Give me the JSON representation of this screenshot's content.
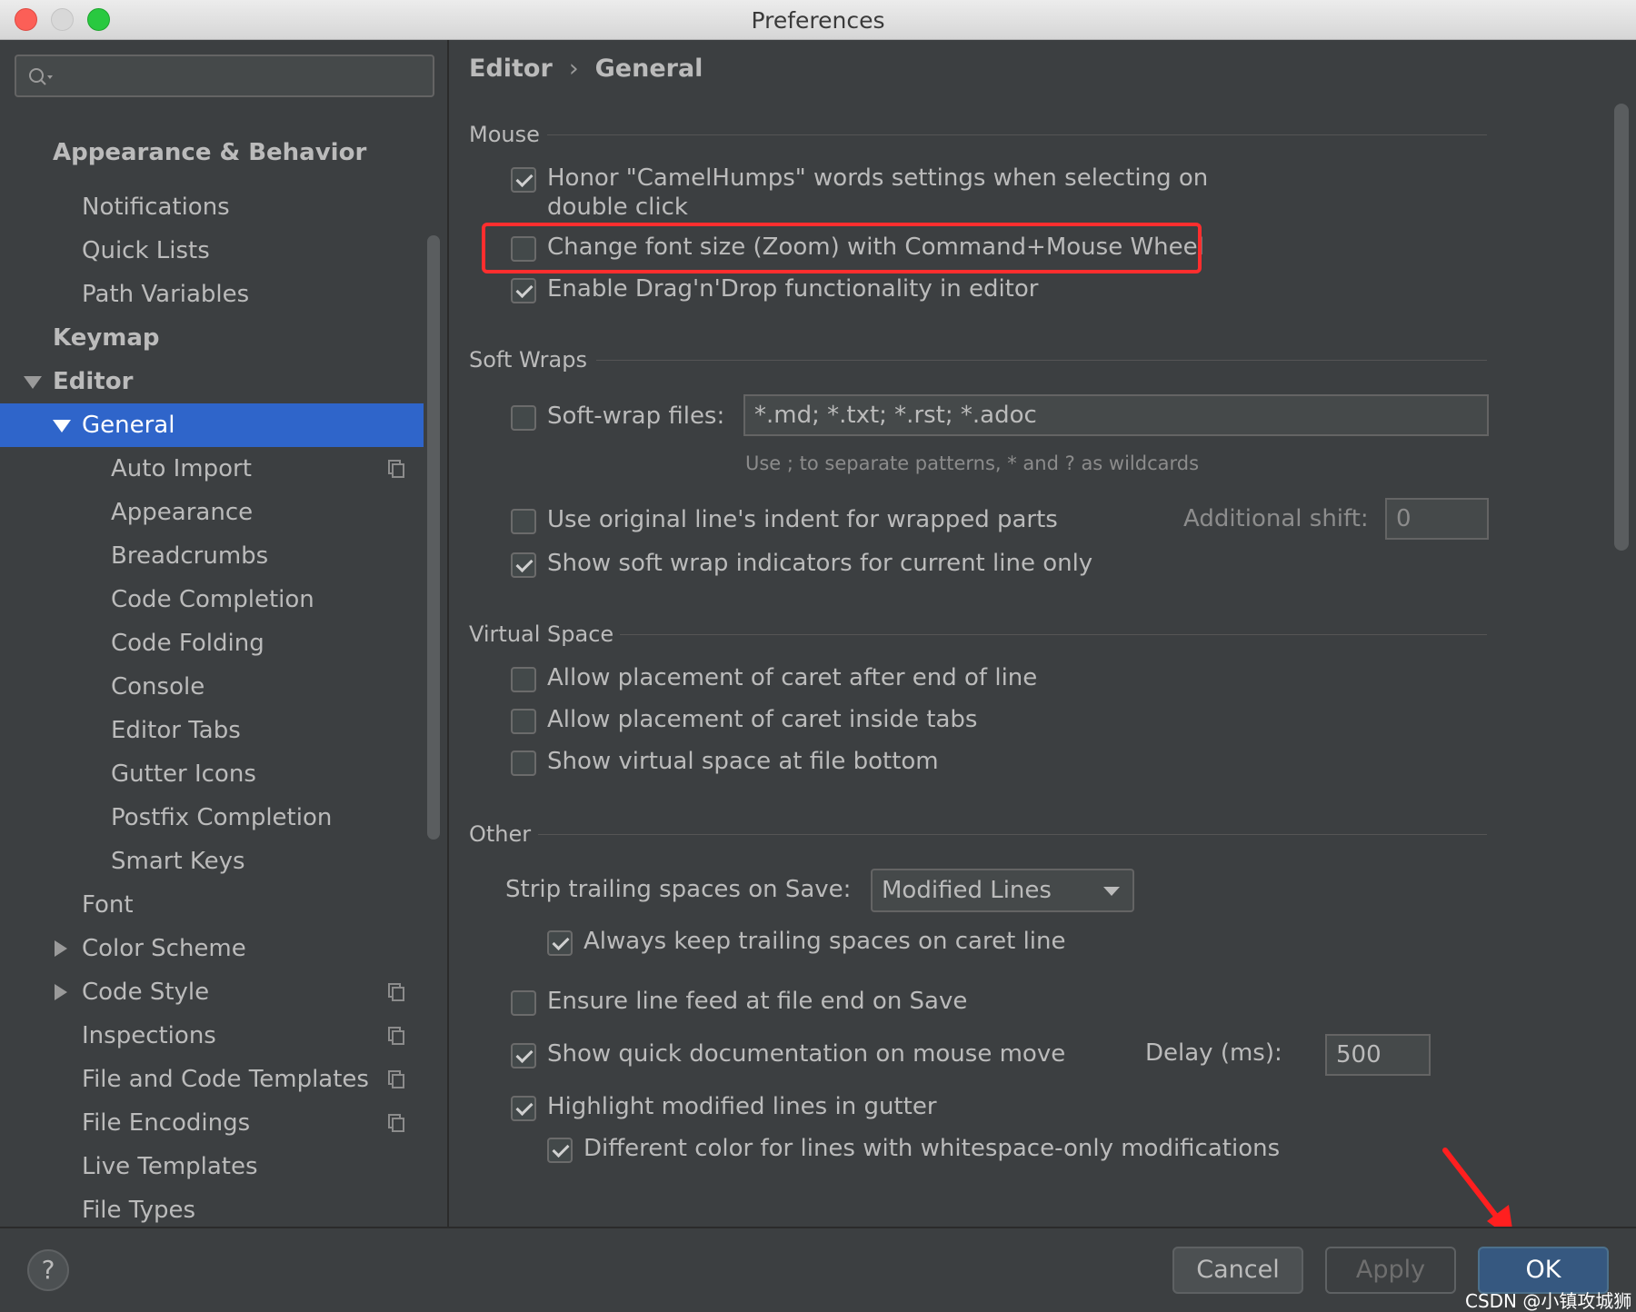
{
  "window": {
    "title": "Preferences"
  },
  "sidebar": {
    "search_placeholder": "",
    "items": [
      {
        "label": "Appearance & Behavior",
        "level": 0,
        "bold": true
      },
      {
        "label": "Notifications",
        "level": 1
      },
      {
        "label": "Quick Lists",
        "level": 1
      },
      {
        "label": "Path Variables",
        "level": 1
      },
      {
        "label": "Keymap",
        "level": 0,
        "bold": true
      },
      {
        "label": "Editor",
        "level": 0,
        "bold": true,
        "expanded": true
      },
      {
        "label": "General",
        "level": 1,
        "expanded": true,
        "selected": true
      },
      {
        "label": "Auto Import",
        "level": 2,
        "icon": "copy-icon"
      },
      {
        "label": "Appearance",
        "level": 2
      },
      {
        "label": "Breadcrumbs",
        "level": 2
      },
      {
        "label": "Code Completion",
        "level": 2
      },
      {
        "label": "Code Folding",
        "level": 2
      },
      {
        "label": "Console",
        "level": 2
      },
      {
        "label": "Editor Tabs",
        "level": 2
      },
      {
        "label": "Gutter Icons",
        "level": 2
      },
      {
        "label": "Postfix Completion",
        "level": 2
      },
      {
        "label": "Smart Keys",
        "level": 2
      },
      {
        "label": "Font",
        "level": 1
      },
      {
        "label": "Color Scheme",
        "level": 1,
        "collapsed": true
      },
      {
        "label": "Code Style",
        "level": 1,
        "collapsed": true,
        "icon": "copy-icon"
      },
      {
        "label": "Inspections",
        "level": 1,
        "icon": "copy-icon"
      },
      {
        "label": "File and Code Templates",
        "level": 1,
        "icon": "copy-icon"
      },
      {
        "label": "File Encodings",
        "level": 1,
        "icon": "copy-icon"
      },
      {
        "label": "Live Templates",
        "level": 1
      },
      {
        "label": "File Types",
        "level": 1
      }
    ]
  },
  "breadcrumb": {
    "parent": "Editor",
    "sep": "›",
    "current": "General"
  },
  "mouse": {
    "title": "Mouse",
    "camelhumps_line1": "Honor \"CamelHumps\" words settings when selecting on",
    "camelhumps_line2": "double click",
    "camelhumps_checked": true,
    "zoom_label": "Change font size (Zoom) with Command+Mouse Wheel",
    "zoom_checked": false,
    "dragdrop_label": "Enable Drag'n'Drop functionality in editor",
    "dragdrop_checked": true
  },
  "soft_wraps": {
    "title": "Soft Wraps",
    "softwrap_label": "Soft-wrap files:",
    "softwrap_checked": false,
    "patterns_value": "*.md; *.txt; *.rst; *.adoc",
    "hint": "Use ; to separate patterns, * and ? as wildcards",
    "indent_label": "Use original line's indent for wrapped parts",
    "indent_checked": false,
    "shift_label": "Additional shift:",
    "shift_value": "0",
    "indicators_label": "Show soft wrap indicators for current line only",
    "indicators_checked": true
  },
  "virtual_space": {
    "title": "Virtual Space",
    "after_end_label": "Allow placement of caret after end of line",
    "inside_tabs_label": "Allow placement of caret inside tabs",
    "file_bottom_label": "Show virtual space at file bottom"
  },
  "other": {
    "title": "Other",
    "strip_label": "Strip trailing spaces on Save:",
    "strip_value": "Modified Lines",
    "keep_trailing_label": "Always keep trailing spaces on caret line",
    "line_feed_label": "Ensure line feed at file end on Save",
    "quick_doc_label": "Show quick documentation on mouse move",
    "delay_label": "Delay (ms):",
    "delay_value": "500",
    "highlight_label": "Highlight modified lines in gutter",
    "diff_color_label": "Different color for lines with whitespace-only modifications"
  },
  "footer": {
    "help": "?",
    "cancel": "Cancel",
    "apply": "Apply",
    "ok": "OK",
    "watermark": "CSDN @小镇攻城狮"
  },
  "colors": {
    "selection": "#2f65ca",
    "highlight_box": "#ff2e2e",
    "ok_button": "#365880"
  }
}
